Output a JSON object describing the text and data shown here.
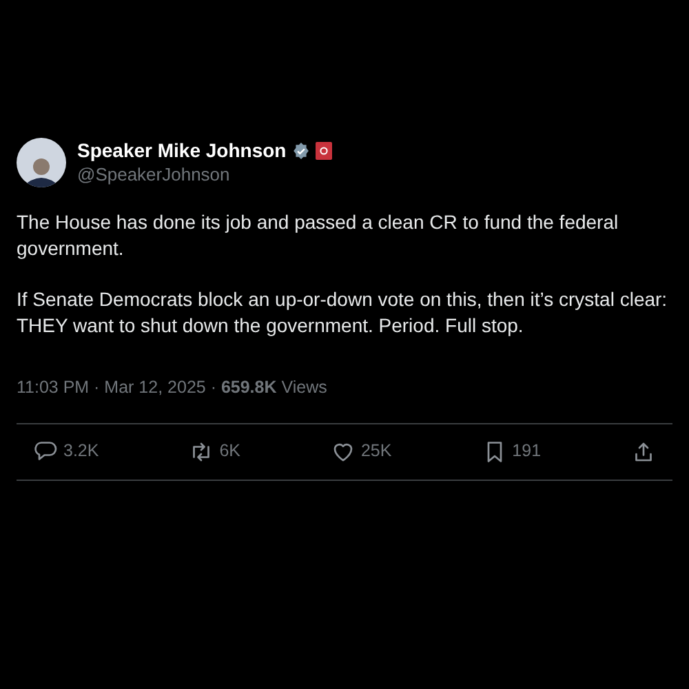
{
  "author": {
    "name": "Speaker Mike Johnson",
    "handle": "@SpeakerJohnson",
    "verified": true,
    "affiliation_badge": true
  },
  "paragraphs": [
    "The House has done its job and passed a clean CR to fund the federal government.",
    "If Senate Democrats block an up-or-down vote on this, then it’s crystal clear: THEY want to shut down the government. Period. Full stop."
  ],
  "meta": "11:03 PM · Mar 12, 2025 · **659.8K** Views",
  "actions": [
    {
      "kind": "reply",
      "count": "3.2K"
    },
    {
      "kind": "repost",
      "count": "6K"
    },
    {
      "kind": "like",
      "count": "25K"
    },
    {
      "kind": "bookmark",
      "count": "191"
    },
    {
      "kind": "share"
    }
  ]
}
